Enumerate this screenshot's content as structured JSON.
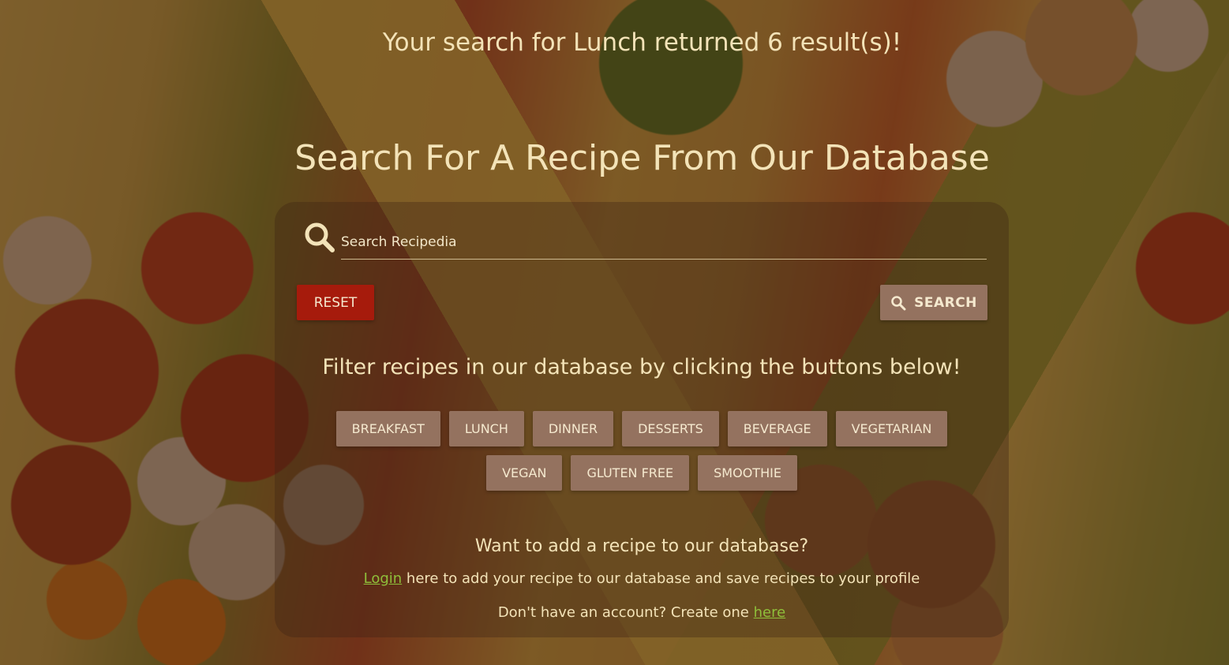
{
  "results_message": "Your search for Lunch returned 6 result(s)!",
  "page_title": "Search For A Recipe From Our Database",
  "search": {
    "placeholder": "Search Recipedia",
    "value": "",
    "icon": "search-icon"
  },
  "buttons": {
    "reset_label": "RESET",
    "search_label": "SEARCH"
  },
  "filter_heading": "Filter recipes in our database by clicking the buttons below!",
  "filters_row1": [
    "BREAKFAST",
    "LUNCH",
    "DINNER",
    "DESSERTS",
    "BEVERAGE",
    "VEGETARIAN"
  ],
  "filters_row2": [
    "VEGAN",
    "GLUTEN FREE",
    "SMOOTHIE"
  ],
  "add_recipe": {
    "heading": "Want to add a recipe to our database?",
    "login_link": "Login",
    "login_text": " here to add your recipe to our database and save recipes to your profile",
    "account_text": "Don't have an account? Create one ",
    "here_link": "here"
  },
  "colors": {
    "reset": "#a61b0c",
    "button": "#94725f",
    "link": "#8fbf3a",
    "text": "#f3e3b8"
  }
}
